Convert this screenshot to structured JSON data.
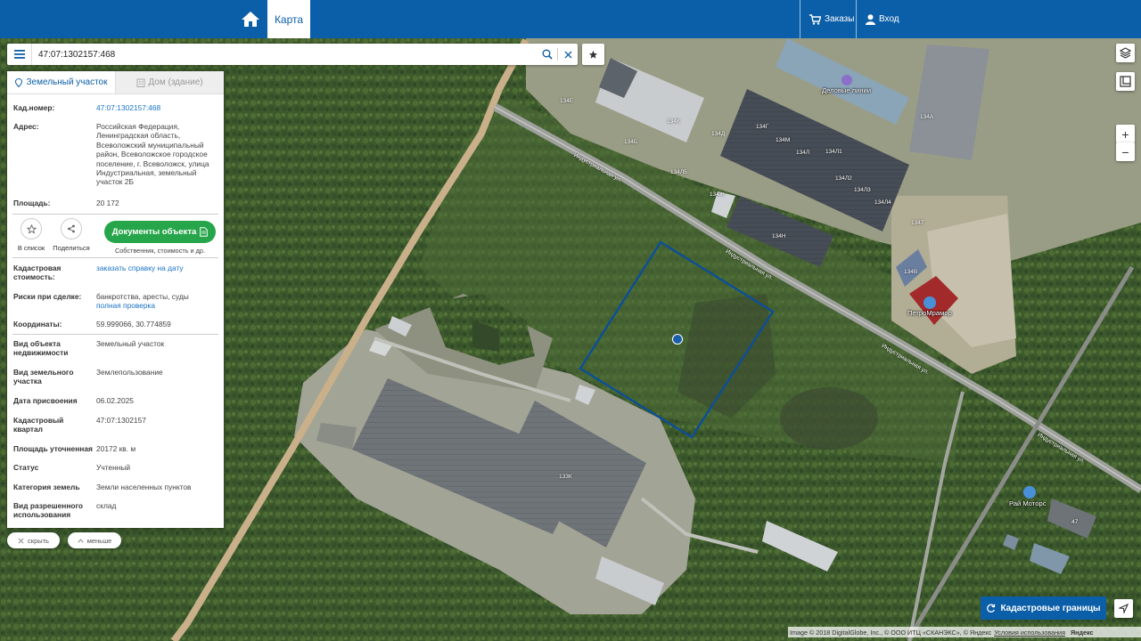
{
  "topbar": {
    "map_tab": "Карта",
    "orders": "Заказы",
    "login": "Вход"
  },
  "search": {
    "value": "47:07:1302157:468"
  },
  "panel": {
    "tabs": {
      "land": "Земельный участок",
      "building": "Дом (здание)"
    },
    "cad_number": {
      "label": "Кад.номер:",
      "value": "47:07:1302157:468"
    },
    "address": {
      "label": "Адрес:",
      "lines": [
        "Российская Федерация,",
        "Ленинградская область,",
        "Всеволожский муниципальный",
        "район, Всеволожское городское",
        "поселение, г. Всеволожск, улица",
        "Индустриальная, земельный",
        "участок 2Б"
      ]
    },
    "area": {
      "label": "Площадь:",
      "value": "20 172"
    },
    "actions": {
      "favorite": "В список",
      "share": "Поделиться",
      "documents": "Документы объекта",
      "documents_sub": "Собственник, стоимость и др."
    },
    "cadastral_value": {
      "label_1": "Кадастровая",
      "label_2": "стоимость:",
      "link": "заказать справку на дату"
    },
    "risks": {
      "label": "Риски при сделке:",
      "value": "банкротства, аресты, суды",
      "link": "полная проверка"
    },
    "coords": {
      "label": "Координаты:",
      "value": "59.999066, 30.774859"
    },
    "details": [
      {
        "label_1": "Вид объекта",
        "label_2": "недвижимости",
        "value": "Земельный участок"
      },
      {
        "label_1": "Вид земельного",
        "label_2": "участка",
        "value": "Землепользование"
      },
      {
        "label_1": "Дата присвоения",
        "label_2": "",
        "value": "06.02.2025"
      },
      {
        "label_1": "Кадастровый",
        "label_2": "квартал",
        "value": "47:07:1302157"
      },
      {
        "label_1": "Площадь уточненная",
        "label_2": "",
        "value": "20172 кв. м"
      },
      {
        "label_1": "Статус",
        "label_2": "",
        "value": "Учтенный"
      },
      {
        "label_1": "Категория земель",
        "label_2": "",
        "value": "Земли населенных пунктов"
      },
      {
        "label_1": "Вид разрешенного",
        "label_2": "использования",
        "value": "склад"
      }
    ]
  },
  "pills": {
    "hide": "скрыть",
    "less": "меньше"
  },
  "map": {
    "labels": {
      "lines": "Деловые линии",
      "petromramor": "ПетроМрамор",
      "rai": "Рай Моторс",
      "street": "Индустриальная ул."
    },
    "building_numbers": [
      "134Е",
      "134К",
      "134Б",
      "134Д",
      "134Г",
      "134М",
      "134Л",
      "134Л1",
      "134Л2",
      "134Л3",
      "134Л4",
      "134Л5",
      "134А",
      "134Ж",
      "134Н",
      "134Т",
      "134В",
      "133К",
      "47"
    ]
  },
  "controls": {
    "zoom_in": "+",
    "zoom_out": "−",
    "cadastral": "Кадастровые границы"
  },
  "copyright": {
    "text": "Image © 2018 DigitalGlobe, Inc., © ООО ИТЦ «СКАНЭКС», © Яндекс",
    "link": "Условия использования",
    "brand": "Яндекс"
  }
}
